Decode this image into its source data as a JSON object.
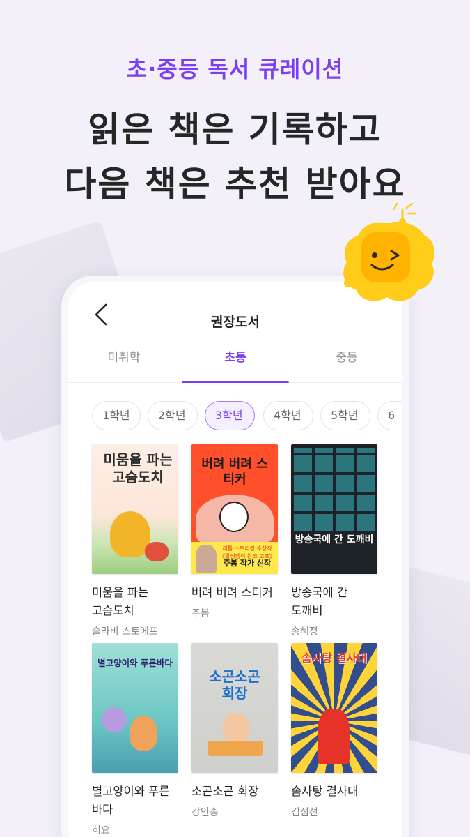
{
  "promo": {
    "subtitle": "초·중등 독서 큐레이션",
    "title_line1": "읽은 책은 기록하고",
    "title_line2": "다음 책은 추천 받아요"
  },
  "app": {
    "header_title": "권장도서",
    "tabs": [
      {
        "label": "미취학",
        "selected": false
      },
      {
        "label": "초등",
        "selected": true
      },
      {
        "label": "중등",
        "selected": false
      }
    ],
    "grades": [
      {
        "label": "1학년",
        "selected": false
      },
      {
        "label": "2학년",
        "selected": false
      },
      {
        "label": "3학년",
        "selected": true
      },
      {
        "label": "4학년",
        "selected": false
      },
      {
        "label": "5학년",
        "selected": false
      },
      {
        "label": "6",
        "selected": false
      }
    ],
    "books": [
      {
        "title": "미움을 파는 고슴도치",
        "author": "슬라비 스토에프",
        "cover_text": "미움을 파는 고슴도치"
      },
      {
        "title": "버려 버려 스티커",
        "author": "주봄",
        "cover_text": "버려 버려 스티커",
        "cover_band_line1": "리틀 스토리킹 수상작 《말썽쟁이 왕코 고포》",
        "cover_band_line2": "주봄 작가 신작"
      },
      {
        "title": "방송국에 간 도깨비",
        "author": "송혜정",
        "cover_text": "방송국에 간 도깨비"
      },
      {
        "title": "별고양이와 푸른 바다",
        "author": "히요",
        "cover_text": "별고양이와 푸른바다"
      },
      {
        "title": "소곤소곤 회장",
        "author": "강인송",
        "cover_text": "소곤소곤 회장"
      },
      {
        "title": "솜사탕 결사대",
        "author": "김점선",
        "cover_text": "솜사탕 결사대"
      }
    ]
  },
  "colors": {
    "accent": "#7b3ff2",
    "background": "#f3f0fa",
    "mascot": "#ffcc1a"
  },
  "icons": {
    "back": "chevron-left-icon",
    "mascot": "smiling-sun-mascot"
  }
}
